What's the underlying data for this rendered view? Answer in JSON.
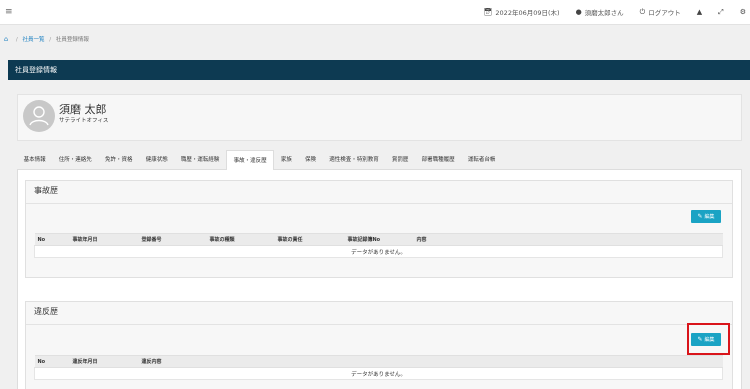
{
  "topbar": {
    "menu_icon": "≡",
    "date": "2022年06月09日(木)",
    "user": "須磨太郎さん",
    "logout": "ログアウト"
  },
  "breadcrumb": {
    "home_icon": "home-icon",
    "items": [
      "社員一覧",
      "社員登録情報"
    ]
  },
  "section": {
    "title": "社員登録情報"
  },
  "profile": {
    "name": "須磨 太郎",
    "office": "サテライトオフィス"
  },
  "tabs": [
    "基本情報",
    "住所・連絡先",
    "免許・資格",
    "健康状態",
    "職歴・運転経験",
    "事故・違反歴",
    "家族",
    "保険",
    "適性検査・特別教育",
    "賞罰歴",
    "部署職種履歴",
    "運転者台帳"
  ],
  "active_tab": "事故・違反歴",
  "accident": {
    "title": "事故歴",
    "edit_label": "編集",
    "columns": [
      "No",
      "事故年月日",
      "登録番号",
      "事故の種類",
      "事故の責任",
      "事故記録簿No",
      "内容"
    ],
    "empty": "データがありません。"
  },
  "violation": {
    "title": "違反歴",
    "edit_label": "編集",
    "columns": [
      "No",
      "違反年月日",
      "違反内容"
    ],
    "empty": "データがありません。"
  },
  "colors": {
    "header_bg": "#0d3a52",
    "button": "#1aa3c4",
    "highlight": "#d9141a"
  }
}
